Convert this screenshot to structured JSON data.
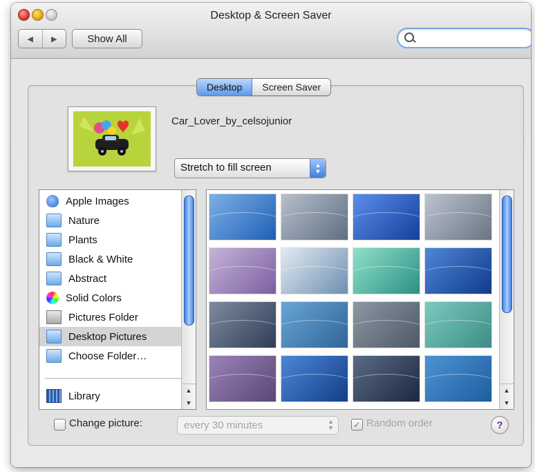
{
  "window": {
    "title": "Desktop & Screen Saver"
  },
  "toolbar": {
    "back_glyph": "◀",
    "forward_glyph": "▶",
    "show_all_label": "Show All",
    "search": {
      "value": "",
      "placeholder": ""
    }
  },
  "tabs": [
    {
      "label": "Desktop",
      "active": true
    },
    {
      "label": "Screen Saver",
      "active": false
    }
  ],
  "current_picture": {
    "name": "Car_Lover_by_celsojunior",
    "placement": "Stretch to fill screen"
  },
  "sources": [
    {
      "label": "Apple Images",
      "icon": "apple-icon"
    },
    {
      "label": "Nature",
      "icon": "folder-icon"
    },
    {
      "label": "Plants",
      "icon": "folder-icon"
    },
    {
      "label": "Black & White",
      "icon": "folder-icon"
    },
    {
      "label": "Abstract",
      "icon": "folder-icon"
    },
    {
      "label": "Solid Colors",
      "icon": "color-wheel-icon"
    },
    {
      "label": "Pictures Folder",
      "icon": "pictures-folder-icon"
    },
    {
      "label": "Desktop Pictures",
      "icon": "folder-icon",
      "selected": true
    },
    {
      "label": "Choose Folder…",
      "icon": "folder-icon"
    },
    {
      "label": "Library",
      "icon": "library-icon"
    }
  ],
  "thumbnails": [
    {
      "colors": [
        "#7fb0e6",
        "#1f5fb6"
      ]
    },
    {
      "colors": [
        "#b7bfca",
        "#5f6f84"
      ]
    },
    {
      "colors": [
        "#5b8ee8",
        "#163f9d"
      ]
    },
    {
      "colors": [
        "#bcc4cf",
        "#6a7483"
      ]
    },
    {
      "colors": [
        "#c5b3d8",
        "#7b5fa1"
      ]
    },
    {
      "colors": [
        "#e3ebf2",
        "#6f8fb0"
      ]
    },
    {
      "colors": [
        "#8fe1c9",
        "#2b8f84"
      ]
    },
    {
      "colors": [
        "#4f86d6",
        "#103b8c"
      ]
    },
    {
      "colors": [
        "#7e8ba0",
        "#2f3d56"
      ]
    },
    {
      "colors": [
        "#6aa4d6",
        "#2f6699"
      ]
    },
    {
      "colors": [
        "#8c97a3",
        "#4e5966"
      ]
    },
    {
      "colors": [
        "#7cc9bd",
        "#3d8d86"
      ]
    },
    {
      "colors": [
        "#9b83b6",
        "#5b4778"
      ]
    },
    {
      "colors": [
        "#4d86d8",
        "#123f87"
      ]
    },
    {
      "colors": [
        "#5a6b86",
        "#1d2740"
      ]
    },
    {
      "colors": [
        "#4f93d4",
        "#1c5e9f"
      ]
    }
  ],
  "bottom": {
    "change_picture_label": "Change picture:",
    "change_picture_checked": false,
    "interval": "every 30 minutes",
    "random_order_label": "Random order",
    "random_order_checked": true,
    "help_label": "?"
  }
}
